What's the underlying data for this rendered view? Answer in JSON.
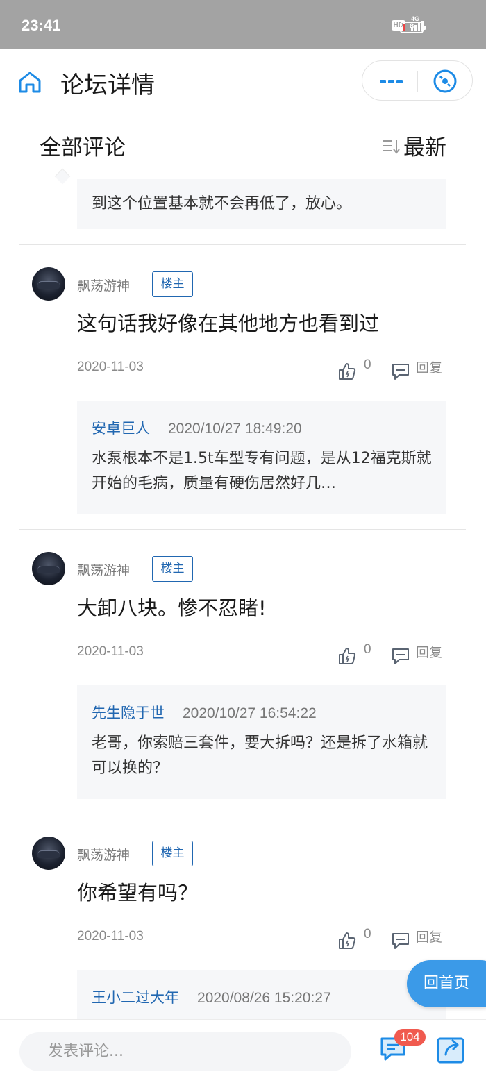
{
  "status_bar": {
    "time": "23:41",
    "hd": "HD",
    "network": "4G",
    "battery": "8"
  },
  "nav": {
    "title": "论坛详情"
  },
  "section": {
    "title": "全部评论",
    "sort_label": "最新"
  },
  "top_quote": {
    "text": "到这个位置基本就不会再低了，放心。"
  },
  "comments": [
    {
      "author": "飘荡游神",
      "badge": "楼主",
      "text": "这句话我好像在其他地方也看到过",
      "date": "2020-11-03",
      "likes": "0",
      "reply_label": "回复",
      "quote": {
        "user": "安卓巨人",
        "time": "2020/10/27 18:49:20",
        "text": "水泵根本不是1.5t车型专有问题，是从12福克斯就开始的毛病，质量有硬伤居然好几…"
      }
    },
    {
      "author": "飘荡游神",
      "badge": "楼主",
      "text": "大卸八块。惨不忍睹!",
      "date": "2020-11-03",
      "likes": "0",
      "reply_label": "回复",
      "quote": {
        "user": "先生隐于世",
        "time": "2020/10/27 16:54:22",
        "text": "老哥，你索赔三套件，要大拆吗？还是拆了水箱就可以换的？"
      }
    },
    {
      "author": "飘荡游神",
      "badge": "楼主",
      "text": "你希望有吗？",
      "date": "2020-11-03",
      "likes": "0",
      "reply_label": "回复",
      "quote": {
        "user": "王小二过大年",
        "time": "2020/08/26 15:20:27",
        "text": ""
      }
    }
  ],
  "floating": {
    "back_home": "回首页"
  },
  "bottom": {
    "placeholder": "发表评论...",
    "message_count": "104"
  },
  "colors": {
    "accent": "#2167b1",
    "icon_blue": "#1d8be6",
    "badge_red": "#f05a4f",
    "floating_button": "#3b9ae8"
  },
  "icons": [
    "home-icon",
    "more-icon",
    "close-icon",
    "sort-icon",
    "like-icon",
    "reply-icon",
    "message-icon",
    "share-icon"
  ]
}
